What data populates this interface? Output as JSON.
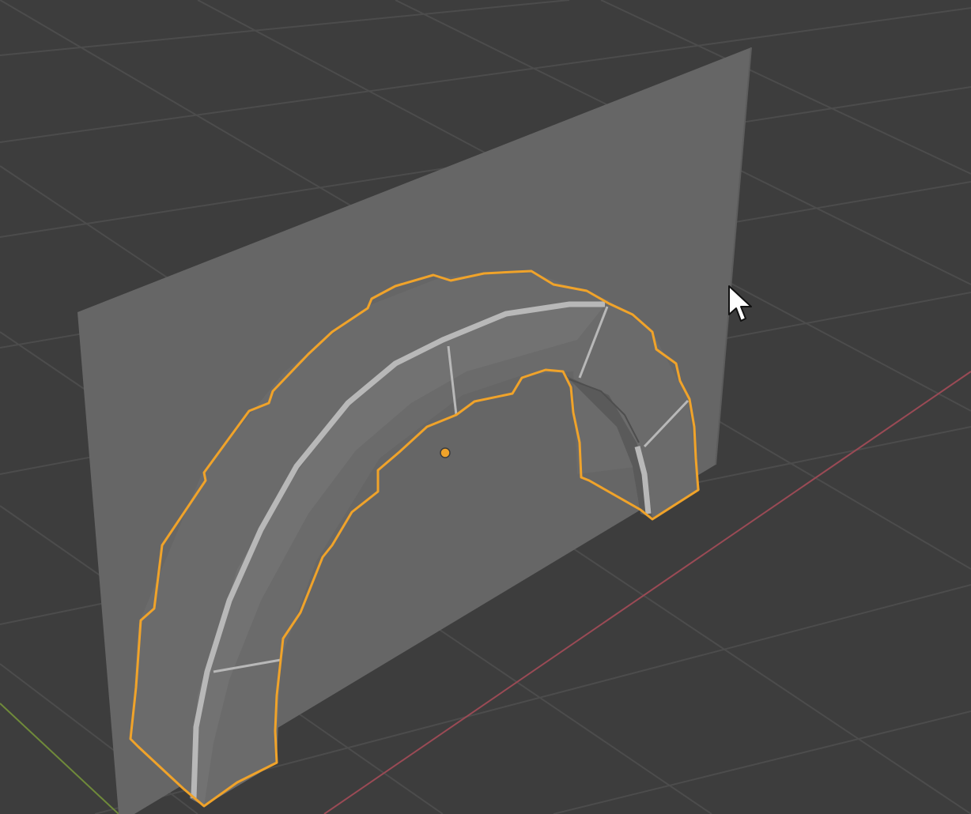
{
  "viewport": {
    "background_color": "#3d3d3d",
    "grid_color": "#4c4c4c",
    "x_axis_color": "#9a4a55",
    "y_axis_color": "#6f8a3a"
  },
  "scene": {
    "backdrop_plane": {
      "color": "#666666"
    },
    "arch_object": {
      "selected": true,
      "selection_outline_color": "#f0a32a",
      "edge_highlight_color": "#b8b8b8",
      "origin_color": "#f0a32a"
    }
  },
  "cursor": {
    "icon": "mouse-pointer-arrow-icon"
  }
}
